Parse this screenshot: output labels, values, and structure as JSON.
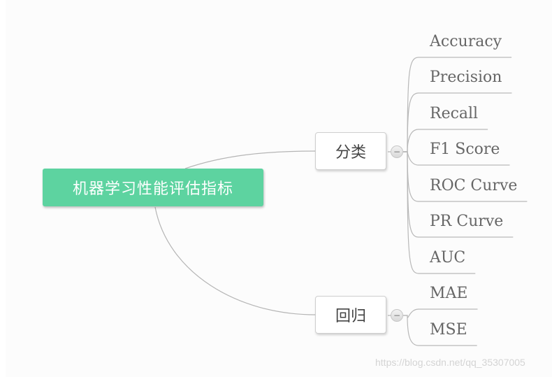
{
  "mindmap": {
    "root": {
      "label": "机器学习性能评估指标",
      "color": "#5dd3a0"
    },
    "branches": [
      {
        "label": "分类",
        "collapse_symbol": "−",
        "children": [
          "Accuracy",
          "Precision",
          "Recall",
          "F1 Score",
          "ROC Curve",
          "PR Curve",
          "AUC"
        ]
      },
      {
        "label": "回归",
        "collapse_symbol": "−",
        "children": [
          "MAE",
          "MSE"
        ]
      }
    ]
  },
  "watermark": "https://blog.csdn.net/qq_35307005"
}
